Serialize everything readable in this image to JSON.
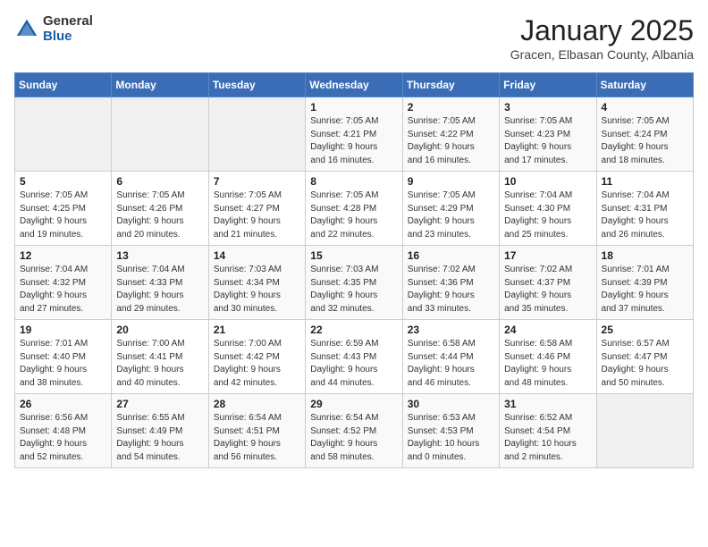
{
  "logo": {
    "general": "General",
    "blue": "Blue"
  },
  "title": "January 2025",
  "subtitle": "Gracen, Elbasan County, Albania",
  "days_of_week": [
    "Sunday",
    "Monday",
    "Tuesday",
    "Wednesday",
    "Thursday",
    "Friday",
    "Saturday"
  ],
  "weeks": [
    [
      {
        "day": "",
        "info": ""
      },
      {
        "day": "",
        "info": ""
      },
      {
        "day": "",
        "info": ""
      },
      {
        "day": "1",
        "info": "Sunrise: 7:05 AM\nSunset: 4:21 PM\nDaylight: 9 hours\nand 16 minutes."
      },
      {
        "day": "2",
        "info": "Sunrise: 7:05 AM\nSunset: 4:22 PM\nDaylight: 9 hours\nand 16 minutes."
      },
      {
        "day": "3",
        "info": "Sunrise: 7:05 AM\nSunset: 4:23 PM\nDaylight: 9 hours\nand 17 minutes."
      },
      {
        "day": "4",
        "info": "Sunrise: 7:05 AM\nSunset: 4:24 PM\nDaylight: 9 hours\nand 18 minutes."
      }
    ],
    [
      {
        "day": "5",
        "info": "Sunrise: 7:05 AM\nSunset: 4:25 PM\nDaylight: 9 hours\nand 19 minutes."
      },
      {
        "day": "6",
        "info": "Sunrise: 7:05 AM\nSunset: 4:26 PM\nDaylight: 9 hours\nand 20 minutes."
      },
      {
        "day": "7",
        "info": "Sunrise: 7:05 AM\nSunset: 4:27 PM\nDaylight: 9 hours\nand 21 minutes."
      },
      {
        "day": "8",
        "info": "Sunrise: 7:05 AM\nSunset: 4:28 PM\nDaylight: 9 hours\nand 22 minutes."
      },
      {
        "day": "9",
        "info": "Sunrise: 7:05 AM\nSunset: 4:29 PM\nDaylight: 9 hours\nand 23 minutes."
      },
      {
        "day": "10",
        "info": "Sunrise: 7:04 AM\nSunset: 4:30 PM\nDaylight: 9 hours\nand 25 minutes."
      },
      {
        "day": "11",
        "info": "Sunrise: 7:04 AM\nSunset: 4:31 PM\nDaylight: 9 hours\nand 26 minutes."
      }
    ],
    [
      {
        "day": "12",
        "info": "Sunrise: 7:04 AM\nSunset: 4:32 PM\nDaylight: 9 hours\nand 27 minutes."
      },
      {
        "day": "13",
        "info": "Sunrise: 7:04 AM\nSunset: 4:33 PM\nDaylight: 9 hours\nand 29 minutes."
      },
      {
        "day": "14",
        "info": "Sunrise: 7:03 AM\nSunset: 4:34 PM\nDaylight: 9 hours\nand 30 minutes."
      },
      {
        "day": "15",
        "info": "Sunrise: 7:03 AM\nSunset: 4:35 PM\nDaylight: 9 hours\nand 32 minutes."
      },
      {
        "day": "16",
        "info": "Sunrise: 7:02 AM\nSunset: 4:36 PM\nDaylight: 9 hours\nand 33 minutes."
      },
      {
        "day": "17",
        "info": "Sunrise: 7:02 AM\nSunset: 4:37 PM\nDaylight: 9 hours\nand 35 minutes."
      },
      {
        "day": "18",
        "info": "Sunrise: 7:01 AM\nSunset: 4:39 PM\nDaylight: 9 hours\nand 37 minutes."
      }
    ],
    [
      {
        "day": "19",
        "info": "Sunrise: 7:01 AM\nSunset: 4:40 PM\nDaylight: 9 hours\nand 38 minutes."
      },
      {
        "day": "20",
        "info": "Sunrise: 7:00 AM\nSunset: 4:41 PM\nDaylight: 9 hours\nand 40 minutes."
      },
      {
        "day": "21",
        "info": "Sunrise: 7:00 AM\nSunset: 4:42 PM\nDaylight: 9 hours\nand 42 minutes."
      },
      {
        "day": "22",
        "info": "Sunrise: 6:59 AM\nSunset: 4:43 PM\nDaylight: 9 hours\nand 44 minutes."
      },
      {
        "day": "23",
        "info": "Sunrise: 6:58 AM\nSunset: 4:44 PM\nDaylight: 9 hours\nand 46 minutes."
      },
      {
        "day": "24",
        "info": "Sunrise: 6:58 AM\nSunset: 4:46 PM\nDaylight: 9 hours\nand 48 minutes."
      },
      {
        "day": "25",
        "info": "Sunrise: 6:57 AM\nSunset: 4:47 PM\nDaylight: 9 hours\nand 50 minutes."
      }
    ],
    [
      {
        "day": "26",
        "info": "Sunrise: 6:56 AM\nSunset: 4:48 PM\nDaylight: 9 hours\nand 52 minutes."
      },
      {
        "day": "27",
        "info": "Sunrise: 6:55 AM\nSunset: 4:49 PM\nDaylight: 9 hours\nand 54 minutes."
      },
      {
        "day": "28",
        "info": "Sunrise: 6:54 AM\nSunset: 4:51 PM\nDaylight: 9 hours\nand 56 minutes."
      },
      {
        "day": "29",
        "info": "Sunrise: 6:54 AM\nSunset: 4:52 PM\nDaylight: 9 hours\nand 58 minutes."
      },
      {
        "day": "30",
        "info": "Sunrise: 6:53 AM\nSunset: 4:53 PM\nDaylight: 10 hours\nand 0 minutes."
      },
      {
        "day": "31",
        "info": "Sunrise: 6:52 AM\nSunset: 4:54 PM\nDaylight: 10 hours\nand 2 minutes."
      },
      {
        "day": "",
        "info": ""
      }
    ]
  ]
}
